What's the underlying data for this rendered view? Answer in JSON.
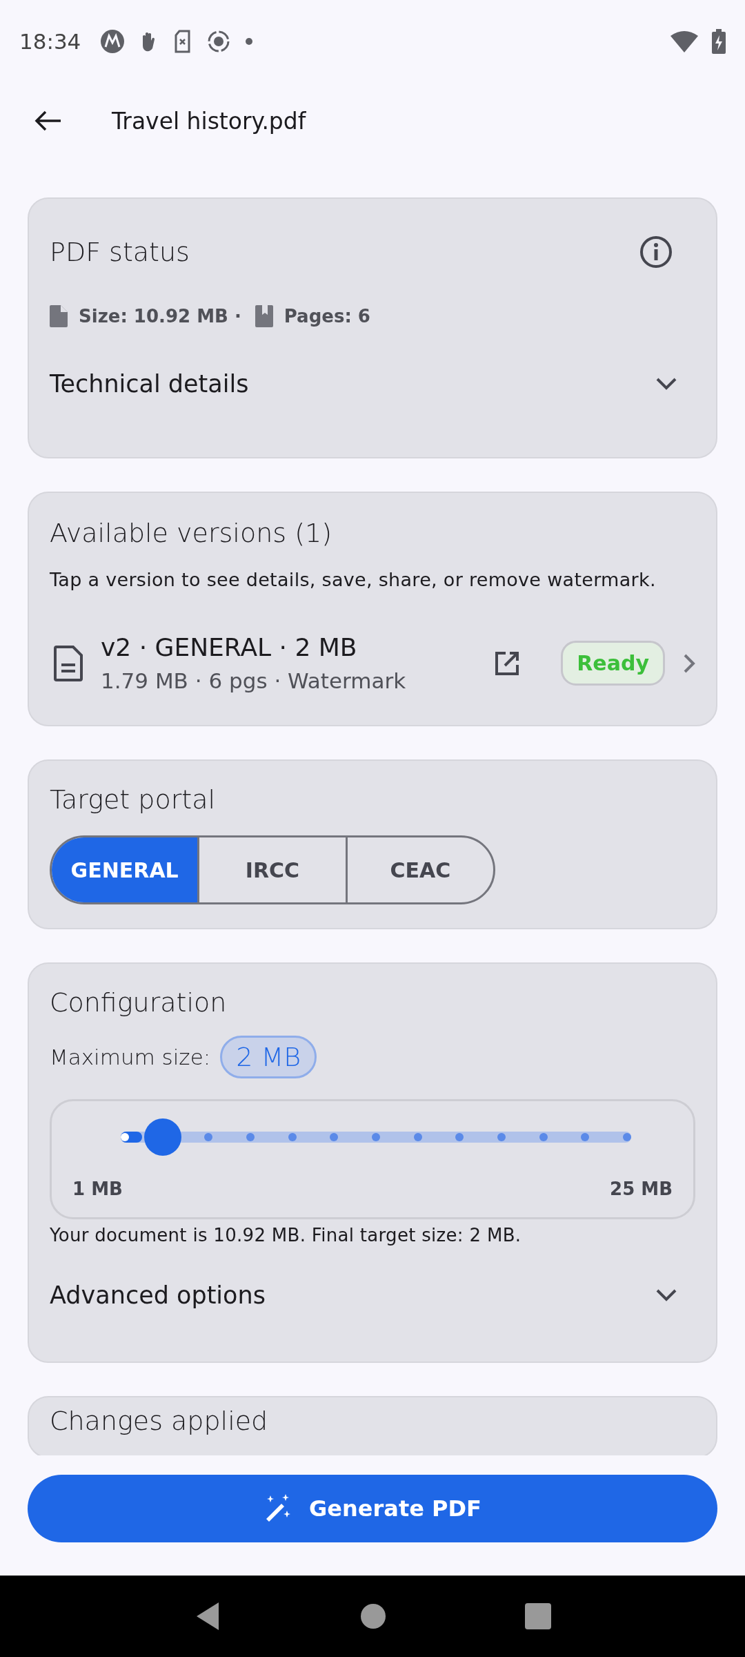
{
  "status_bar": {
    "time": "18:34"
  },
  "header": {
    "title": "Travel history.pdf"
  },
  "pdf_status": {
    "title": "PDF status",
    "size": "Size: 10.92 MB ·",
    "pages": "Pages: 6",
    "technical_details": {
      "label": "Technical details",
      "expanded": false
    }
  },
  "versions": {
    "title": "Available versions (1)",
    "hint": "Tap a version to see details, save, share, or remove watermark.",
    "items": [
      {
        "title": "v2 · GENERAL · 2 MB",
        "subtitle": "1.79 MB · 6 pgs · Watermark",
        "status": "Ready"
      }
    ]
  },
  "target_portal": {
    "title": "Target portal",
    "options": [
      {
        "label": "GENERAL",
        "selected": true
      },
      {
        "label": "IRCC",
        "selected": false
      },
      {
        "label": "CEAC",
        "selected": false
      }
    ]
  },
  "configuration": {
    "title": "Configuration",
    "max_size_label": "Maximum size:",
    "max_size_value": "2 MB",
    "slider": {
      "level": 0.083,
      "min_label": "1 MB",
      "max_label": "25 MB"
    },
    "summary": "Your document is 10.92 MB. Final target size: 2 MB.",
    "advanced_options": {
      "label": "Advanced options",
      "expanded": false
    }
  },
  "changes": {
    "title": "Changes applied"
  },
  "generate_button": {
    "label": "Generate PDF"
  }
}
